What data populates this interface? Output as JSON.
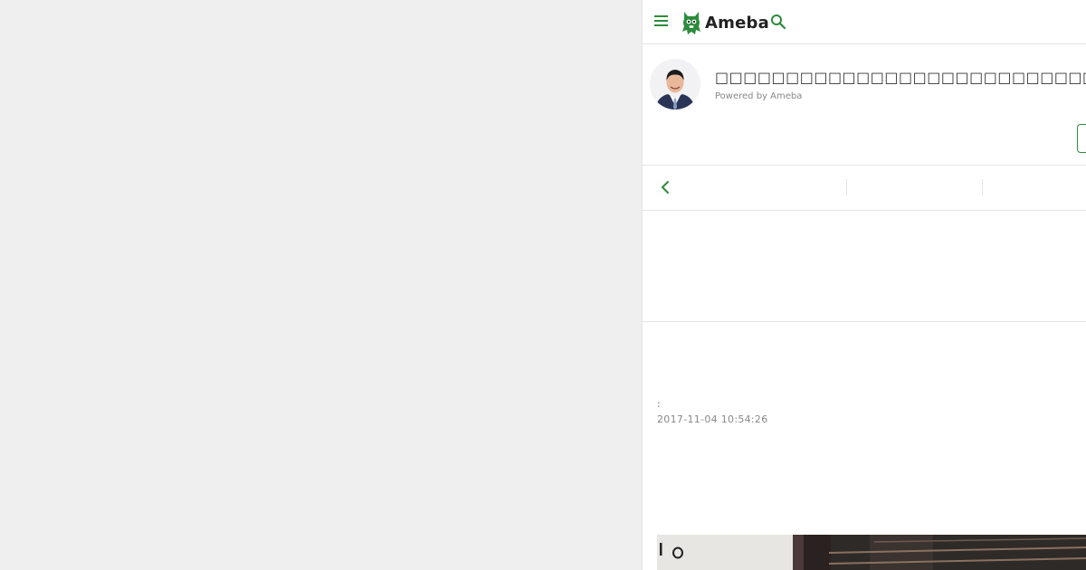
{
  "header": {
    "menu_icon": "hamburger-menu-icon",
    "logo_text": "Ameba",
    "logo_mascot_icon": "ameba-mascot-icon",
    "search_icon": "search-icon"
  },
  "blog": {
    "title": "□□□□□□□□□□□□□□□□□□□□□□□□□□□□□□□□□□",
    "powered_by": "Powered by Ameba",
    "avatar": "avatar-portrait-image"
  },
  "nav": {
    "back_icon": "chevron-left-icon"
  },
  "entry": {
    "theme": ":",
    "date": "2017-11-04 10:54:26"
  },
  "colors": {
    "accent": "#2d8c3c",
    "background": "#efefef",
    "panel": "#ffffff",
    "divider": "#e6e6e6"
  }
}
